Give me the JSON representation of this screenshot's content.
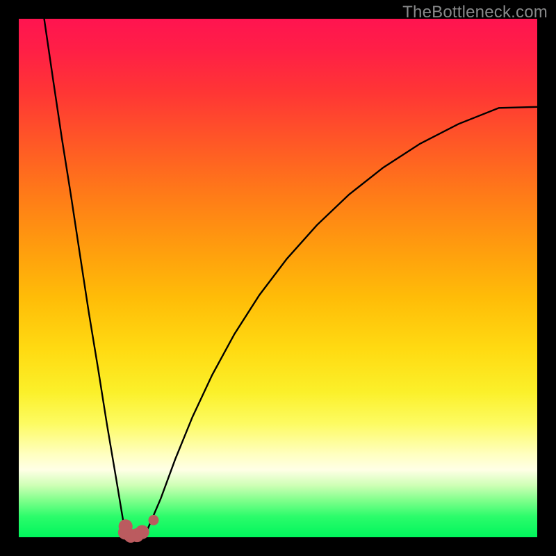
{
  "watermark": "TheBottleneck.com",
  "colors": {
    "frame": "#000000",
    "curve_stroke": "#000000",
    "marker_fill": "#bb5b5f",
    "gradient_top": "#ff1450",
    "gradient_bottom": "#00f65c"
  },
  "chart_data": {
    "type": "line",
    "title": "",
    "xlabel": "",
    "ylabel": "",
    "xlim": [
      0,
      1
    ],
    "ylim": [
      0,
      1
    ],
    "note": "No axes, ticks, or numeric labels are rendered. Curve coordinates are normalized to the plot area (0–1 on each axis, y increasing upward). The plot depicts a bottleneck-style curve: a steep V dipping to ~0 near x≈0.21–0.24, with the right branch rising toward ~0.83 at the right edge. A few rounded markers sit near the trough.",
    "series": [
      {
        "name": "left-branch",
        "x": [
          0.049,
          0.066,
          0.083,
          0.101,
          0.118,
          0.135,
          0.153,
          0.17,
          0.188,
          0.205
        ],
        "y": [
          1.0,
          0.884,
          0.77,
          0.657,
          0.545,
          0.434,
          0.325,
          0.218,
          0.112,
          0.01
        ]
      },
      {
        "name": "trough",
        "x": [
          0.205,
          0.215,
          0.225,
          0.235,
          0.247
        ],
        "y": [
          0.01,
          0.002,
          0.001,
          0.003,
          0.012
        ]
      },
      {
        "name": "right-branch",
        "x": [
          0.247,
          0.274,
          0.302,
          0.335,
          0.373,
          0.416,
          0.464,
          0.517,
          0.575,
          0.637,
          0.703,
          0.774,
          0.848,
          0.926,
          1.0
        ],
        "y": [
          0.012,
          0.075,
          0.151,
          0.232,
          0.313,
          0.392,
          0.467,
          0.537,
          0.602,
          0.661,
          0.713,
          0.759,
          0.797,
          0.828,
          0.83
        ]
      }
    ],
    "markers": [
      {
        "x": 0.206,
        "y": 0.021,
        "r": 0.0135
      },
      {
        "x": 0.205,
        "y": 0.009,
        "r": 0.0135
      },
      {
        "x": 0.216,
        "y": 0.003,
        "r": 0.0135
      },
      {
        "x": 0.228,
        "y": 0.004,
        "r": 0.0135
      },
      {
        "x": 0.238,
        "y": 0.01,
        "r": 0.0135
      },
      {
        "x": 0.26,
        "y": 0.033,
        "r": 0.01
      }
    ]
  }
}
